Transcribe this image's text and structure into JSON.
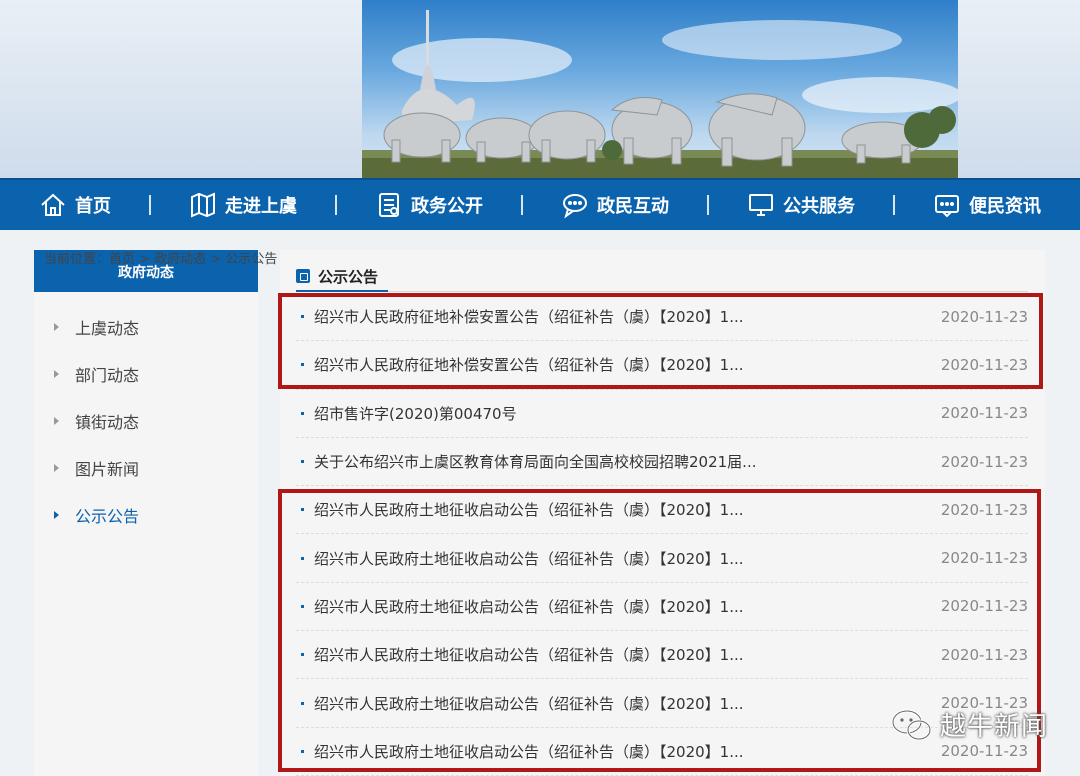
{
  "nav": {
    "items": [
      {
        "label": "首页",
        "icon": "home-icon"
      },
      {
        "label": "走进上虞",
        "icon": "map-icon"
      },
      {
        "label": "政务公开",
        "icon": "document-icon"
      },
      {
        "label": "政民互动",
        "icon": "chat-icon"
      },
      {
        "label": "公共服务",
        "icon": "monitor-icon"
      },
      {
        "label": "便民资讯",
        "icon": "message-icon"
      }
    ]
  },
  "breadcrumb": {
    "prefix": "当前位置：",
    "home": "首页",
    "sep": " > ",
    "section": "政府动态",
    "current": "公示公告"
  },
  "sidebar": {
    "title": "政府动态",
    "items": [
      {
        "label": "上虞动态",
        "active": false
      },
      {
        "label": "部门动态",
        "active": false
      },
      {
        "label": "镇街动态",
        "active": false
      },
      {
        "label": "图片新闻",
        "active": false
      },
      {
        "label": "公示公告",
        "active": true
      }
    ]
  },
  "main": {
    "tab_label": "公示公告",
    "rows": [
      {
        "title": "绍兴市人民政府征地补偿安置公告（绍征补告（虞）【2020】1...",
        "date": "2020-11-23"
      },
      {
        "title": "绍兴市人民政府征地补偿安置公告（绍征补告（虞）【2020】1...",
        "date": "2020-11-23"
      },
      {
        "title": "绍市售许字(2020)第00470号",
        "date": "2020-11-23"
      },
      {
        "title": "关于公布绍兴市上虞区教育体育局面向全国高校校园招聘2021届...",
        "date": "2020-11-23"
      },
      {
        "title": "绍兴市人民政府土地征收启动公告（绍征补告（虞）【2020】1...",
        "date": "2020-11-23"
      },
      {
        "title": "绍兴市人民政府土地征收启动公告（绍征补告（虞）【2020】1...",
        "date": "2020-11-23"
      },
      {
        "title": "绍兴市人民政府土地征收启动公告（绍征补告（虞）【2020】1...",
        "date": "2020-11-23"
      },
      {
        "title": "绍兴市人民政府土地征收启动公告（绍征补告（虞）【2020】1...",
        "date": "2020-11-23"
      },
      {
        "title": "绍兴市人民政府土地征收启动公告（绍征补告（虞）【2020】1...",
        "date": "2020-11-23"
      },
      {
        "title": "绍兴市人民政府土地征收启动公告（绍征补告（虞）【2020】1...",
        "date": "2020-11-23"
      }
    ]
  },
  "watermark": {
    "text": "越牛新闻",
    "icon": "wechat-icon"
  },
  "colors": {
    "brand": "#0b62ad",
    "highlight": "#b01818"
  }
}
